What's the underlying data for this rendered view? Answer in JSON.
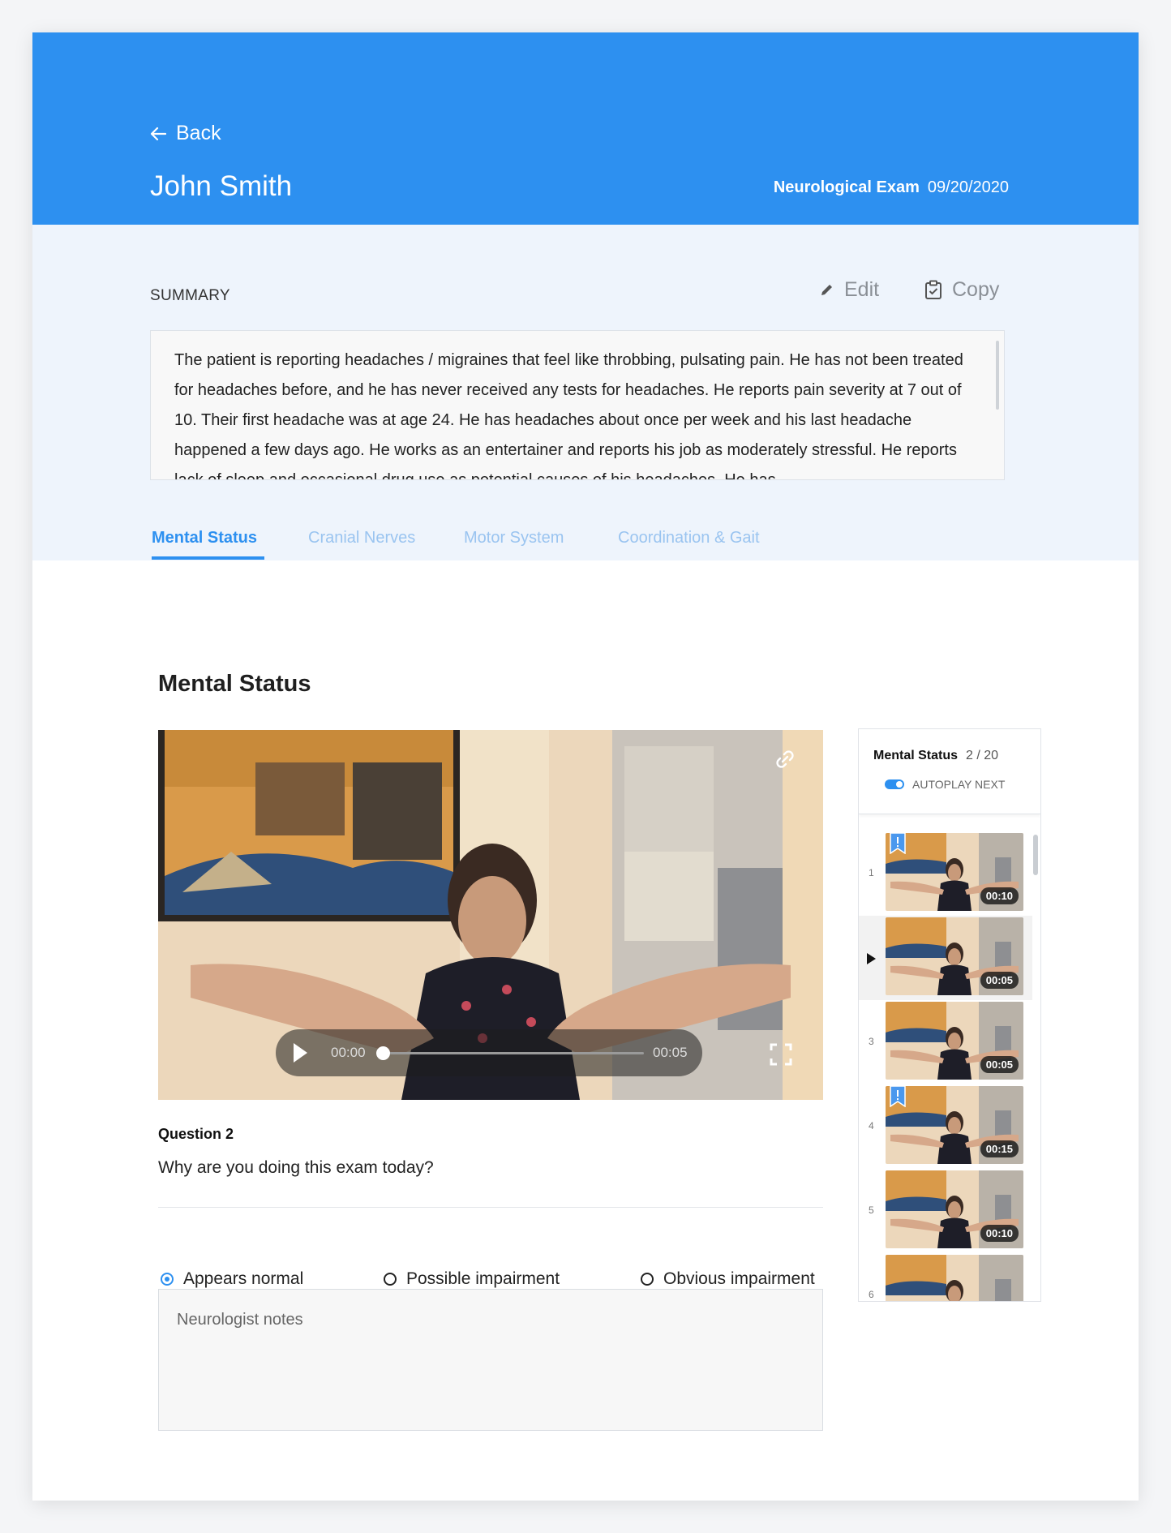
{
  "header": {
    "back_label": "Back",
    "patient_name": "John Smith",
    "exam_type": "Neurological Exam",
    "exam_date": "09/20/2020",
    "bg_color": "#2d90f0"
  },
  "summary": {
    "label": "SUMMARY",
    "edit_label": "Edit",
    "copy_label": "Copy",
    "text": "The patient is reporting headaches / migraines that feel like throbbing, pulsating pain. He has not been treated for headaches before, and he has never received any tests for headaches. He reports pain severity at 7 out of 10. Their first headache was at age 24. He has headaches about once per week and his last headache happened a few days ago. He works as an entertainer and reports his job as moderately stressful. He reports lack of sleep and occasional drug use as potential causes of his headaches. He has"
  },
  "tabs": [
    {
      "label": "Mental Status",
      "active": true
    },
    {
      "label": "Cranial Nerves",
      "active": false
    },
    {
      "label": "Motor System",
      "active": false
    },
    {
      "label": "Coordination & Gait",
      "active": false
    }
  ],
  "section": {
    "title": "Mental Status"
  },
  "video": {
    "current_time": "00:00",
    "total_time": "00:05",
    "progress": 0,
    "link_icon": "link-icon",
    "fullscreen_icon": "fullscreen-icon"
  },
  "question": {
    "label": "Question 2",
    "text": "Why are you doing this exam today?"
  },
  "assessment": {
    "options": [
      "Appears normal",
      "Possible impairment",
      "Obvious impairment"
    ],
    "selected": "Appears normal"
  },
  "notes": {
    "placeholder": "Neurologist notes",
    "value": ""
  },
  "playlist": {
    "title": "Mental Status",
    "count": "2 / 20",
    "autoplay_label": "AUTOPLAY NEXT",
    "autoplay_on": true,
    "items": [
      {
        "number": "1",
        "duration": "00:10",
        "flagged": true,
        "current": false
      },
      {
        "number": "",
        "duration": "00:05",
        "flagged": false,
        "current": true
      },
      {
        "number": "3",
        "duration": "00:05",
        "flagged": false,
        "current": false
      },
      {
        "number": "4",
        "duration": "00:15",
        "flagged": true,
        "current": false
      },
      {
        "number": "5",
        "duration": "00:10",
        "flagged": false,
        "current": false
      },
      {
        "number": "6",
        "duration": "",
        "flagged": false,
        "current": false
      }
    ]
  }
}
